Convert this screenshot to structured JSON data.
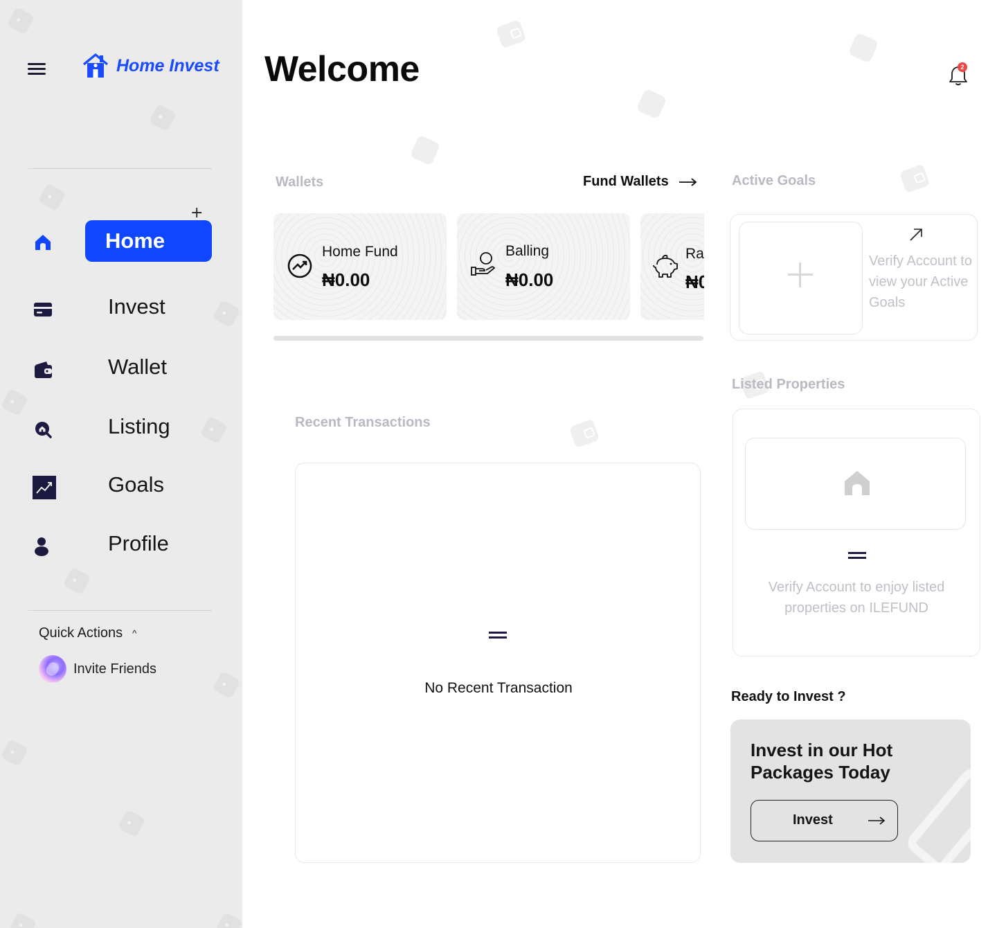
{
  "app": {
    "name": "Home Invest",
    "brand_color": "#1146ff",
    "logo_color": "#1a4bff"
  },
  "sidebar": {
    "items": [
      {
        "label": "Home",
        "icon": "home-icon",
        "active": true
      },
      {
        "label": "Invest",
        "icon": "card-icon",
        "active": false
      },
      {
        "label": "Wallet",
        "icon": "wallet-icon",
        "active": false
      },
      {
        "label": "Listing",
        "icon": "search-house-icon",
        "active": false
      },
      {
        "label": "Goals",
        "icon": "trend-chart-icon",
        "active": false
      },
      {
        "label": "Profile",
        "icon": "user-icon",
        "active": false
      }
    ],
    "quick_actions": {
      "title": "Quick Actions",
      "expanded": true,
      "items": [
        {
          "label": "Invite Friends",
          "icon": "invite-avatar"
        }
      ]
    }
  },
  "header": {
    "title": "Welcome",
    "notifications_count": "2"
  },
  "wallets": {
    "title": "Wallets",
    "fund_link": "Fund Wallets",
    "items": [
      {
        "name": "Home Fund",
        "amount": "₦0.00",
        "icon": "growth-circle-icon"
      },
      {
        "name": "Balling",
        "amount": "₦0.00",
        "icon": "hand-coin-icon"
      },
      {
        "name": "Ra",
        "amount": "₦0",
        "icon": "piggy-bank-icon"
      }
    ]
  },
  "goals": {
    "title": "Active Goals",
    "message": "Verify Account to view your Active Goals"
  },
  "transactions": {
    "title": "Recent Transactions",
    "empty_message": "No Recent Transaction"
  },
  "properties": {
    "title": "Listed Properties",
    "message": "Verify Account to enjoy listed properties on ILEFUND"
  },
  "promo": {
    "heading": "Ready to Invest ?",
    "title": "Invest in our Hot Packages Today",
    "button_label": "Invest"
  }
}
